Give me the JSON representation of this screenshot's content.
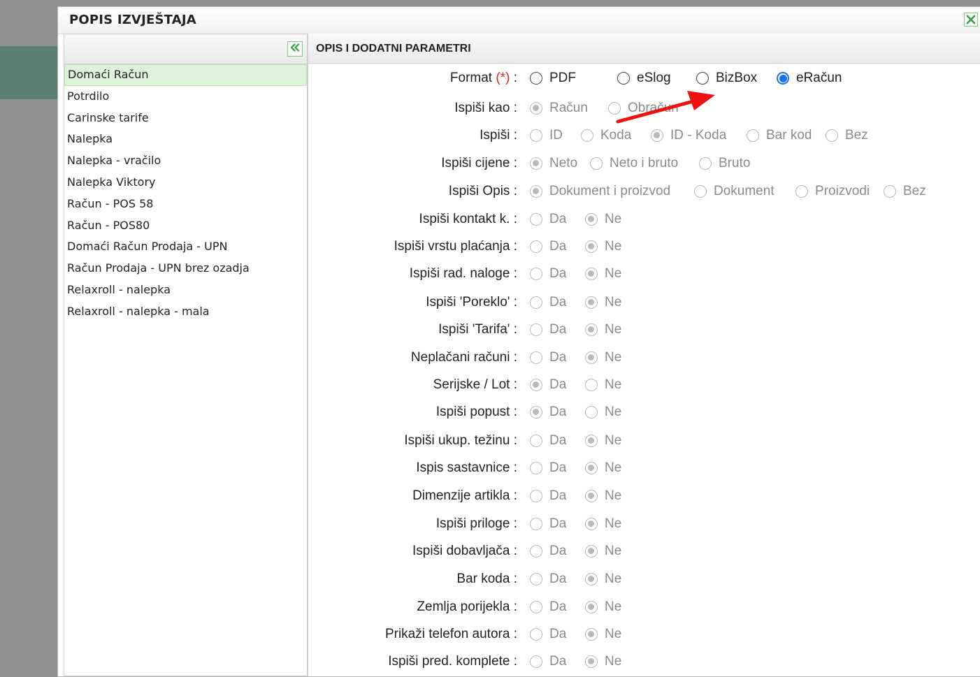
{
  "dialog": {
    "title": "POPIS IZVJEŠTAJA",
    "close_icon": "close-x-icon"
  },
  "left_panel": {
    "collapse_icon": "double-chevron-left-icon",
    "items": [
      {
        "label": "Domaći Račun",
        "selected": true
      },
      {
        "label": "Potrdilo"
      },
      {
        "label": "Carinske tarife"
      },
      {
        "label": "Nalepka"
      },
      {
        "label": "Nalepka - vračilo"
      },
      {
        "label": "Nalepka Viktory"
      },
      {
        "label": "Račun - POS 58"
      },
      {
        "label": "Račun - POS80"
      },
      {
        "label": "Domaći Račun Prodaja - UPN"
      },
      {
        "label": "Račun Prodaja - UPN brez ozadja"
      },
      {
        "label": "Relaxroll - nalepka"
      },
      {
        "label": "Relaxroll - nalepka - mala"
      }
    ]
  },
  "right_panel": {
    "title": "OPIS I DODATNI PARAMETRI",
    "rows": [
      {
        "label": "Format",
        "required": "(*)",
        "enabled": true,
        "options": [
          {
            "label": "PDF"
          },
          {
            "label": "eSlog"
          },
          {
            "label": "BizBox"
          },
          {
            "label": "eRačun",
            "checked": true
          }
        ]
      },
      {
        "label": "Ispiši kao",
        "options": [
          {
            "label": "Račun",
            "checked": true
          },
          {
            "label": "Obračun"
          }
        ]
      },
      {
        "label": "Ispiši",
        "options": [
          {
            "label": "ID"
          },
          {
            "label": "Koda"
          },
          {
            "label": "ID - Koda",
            "checked": true
          },
          {
            "label": "Bar kod"
          },
          {
            "label": "Bez"
          }
        ]
      },
      {
        "label": "Ispiši cijene",
        "options": [
          {
            "label": "Neto",
            "checked": true
          },
          {
            "label": "Neto i bruto"
          },
          {
            "label": "Bruto"
          }
        ]
      },
      {
        "label": "Ispiši Opis",
        "options": [
          {
            "label": "Dokument i proizvod",
            "checked": true
          },
          {
            "label": "Dokument"
          },
          {
            "label": "Proizvodi"
          },
          {
            "label": "Bez"
          }
        ]
      },
      {
        "label": "Ispiši kontakt k.",
        "options": [
          {
            "label": "Da"
          },
          {
            "label": "Ne",
            "checked": true
          }
        ]
      },
      {
        "label": "Ispiši vrstu plaćanja",
        "options": [
          {
            "label": "Da"
          },
          {
            "label": "Ne",
            "checked": true
          }
        ]
      },
      {
        "label": "Ispiši rad. naloge",
        "options": [
          {
            "label": "Da"
          },
          {
            "label": "Ne",
            "checked": true
          }
        ]
      },
      {
        "label": "Ispiši 'Poreklo'",
        "options": [
          {
            "label": "Da"
          },
          {
            "label": "Ne",
            "checked": true
          }
        ]
      },
      {
        "label": "Ispiši 'Tarifa'",
        "options": [
          {
            "label": "Da"
          },
          {
            "label": "Ne",
            "checked": true
          }
        ]
      },
      {
        "label": "Neplačani računi",
        "options": [
          {
            "label": "Da"
          },
          {
            "label": "Ne",
            "checked": true
          }
        ]
      },
      {
        "label": "Serijske / Lot",
        "options": [
          {
            "label": "Da",
            "checked": true
          },
          {
            "label": "Ne"
          }
        ]
      },
      {
        "label": "Ispiši popust",
        "options": [
          {
            "label": "Da",
            "checked": true
          },
          {
            "label": "Ne"
          }
        ]
      },
      {
        "label": "Ispiši ukup. težinu",
        "options": [
          {
            "label": "Da"
          },
          {
            "label": "Ne",
            "checked": true
          }
        ]
      },
      {
        "label": "Ispis sastavnice",
        "options": [
          {
            "label": "Da"
          },
          {
            "label": "Ne",
            "checked": true
          }
        ]
      },
      {
        "label": "Dimenzije artikla",
        "options": [
          {
            "label": "Da"
          },
          {
            "label": "Ne",
            "checked": true
          }
        ]
      },
      {
        "label": "Ispiši priloge",
        "options": [
          {
            "label": "Da"
          },
          {
            "label": "Ne",
            "checked": true
          }
        ]
      },
      {
        "label": "Ispiši dobavljača",
        "options": [
          {
            "label": "Da"
          },
          {
            "label": "Ne",
            "checked": true
          }
        ]
      },
      {
        "label": "Bar koda",
        "options": [
          {
            "label": "Da"
          },
          {
            "label": "Ne",
            "checked": true
          }
        ]
      },
      {
        "label": "Zemlja porijekla",
        "options": [
          {
            "label": "Da"
          },
          {
            "label": "Ne",
            "checked": true
          }
        ]
      },
      {
        "label": "Prikaži telefon autora",
        "options": [
          {
            "label": "Da"
          },
          {
            "label": "Ne",
            "checked": true
          }
        ]
      },
      {
        "label": "Ispiši pred. komplete",
        "options": [
          {
            "label": "Da"
          },
          {
            "label": "Ne",
            "checked": true
          }
        ]
      }
    ]
  },
  "annotation": {
    "arrow_color": "#ee1111",
    "arrow_icon": "red-arrow-annotation"
  },
  "colors": {
    "selected_item_bg": "#dcf3d9",
    "active_radio": "#1a73e8",
    "required_marker": "#e02020",
    "backdrop": "#8f8f8f",
    "backdrop_strip": "#5d7f72"
  }
}
